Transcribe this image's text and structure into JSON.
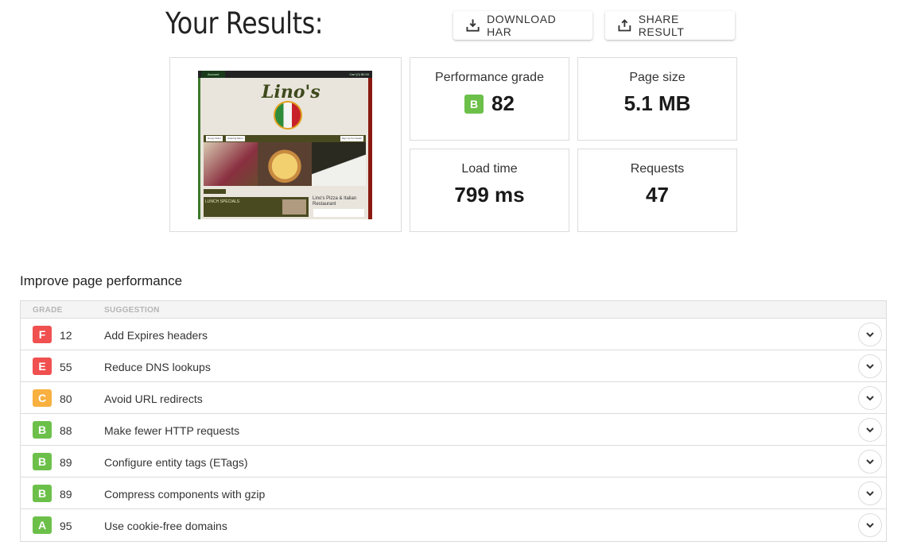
{
  "header": {
    "title": "Your Results:",
    "download_har_label": "DOWNLOAD HAR",
    "share_result_label": "SHARE RESULT"
  },
  "preview": {
    "account_label": "Account",
    "cart_label": "Cart (0)  $0.00",
    "logo_text": "Lino's",
    "nav_items": [
      "Group Order",
      "Catering Menu",
      "Sign Up For Deals!"
    ],
    "expand_menu": "Expand Menu",
    "lunch_title": "LUNCH SPECIALS",
    "lunch_subtitle": "*Available from 11:00 a.m. to 3:00 p.m.*",
    "restaurant_name": "Lino's Pizza & Italian Restaurant"
  },
  "metrics": {
    "performance_grade": {
      "label": "Performance grade",
      "grade": "B",
      "value": "82",
      "color": "#6cc04a"
    },
    "page_size": {
      "label": "Page size",
      "value": "5.1 MB"
    },
    "load_time": {
      "label": "Load time",
      "value": "799 ms"
    },
    "requests": {
      "label": "Requests",
      "value": "47"
    }
  },
  "improve": {
    "title": "Improve page performance",
    "columns": {
      "grade": "GRADE",
      "suggestion": "SUGGESTION"
    },
    "rows": [
      {
        "grade": "F",
        "score": "12",
        "suggestion": "Add Expires headers",
        "color": "#f05050"
      },
      {
        "grade": "E",
        "score": "55",
        "suggestion": "Reduce DNS lookups",
        "color": "#f05050"
      },
      {
        "grade": "C",
        "score": "80",
        "suggestion": "Avoid URL redirects",
        "color": "#f8b040"
      },
      {
        "grade": "B",
        "score": "88",
        "suggestion": "Make fewer HTTP requests",
        "color": "#6cc04a"
      },
      {
        "grade": "B",
        "score": "89",
        "suggestion": "Configure entity tags (ETags)",
        "color": "#6cc04a"
      },
      {
        "grade": "B",
        "score": "89",
        "suggestion": "Compress components with gzip",
        "color": "#6cc04a"
      },
      {
        "grade": "A",
        "score": "95",
        "suggestion": "Use cookie-free domains",
        "color": "#6cc04a"
      }
    ]
  }
}
